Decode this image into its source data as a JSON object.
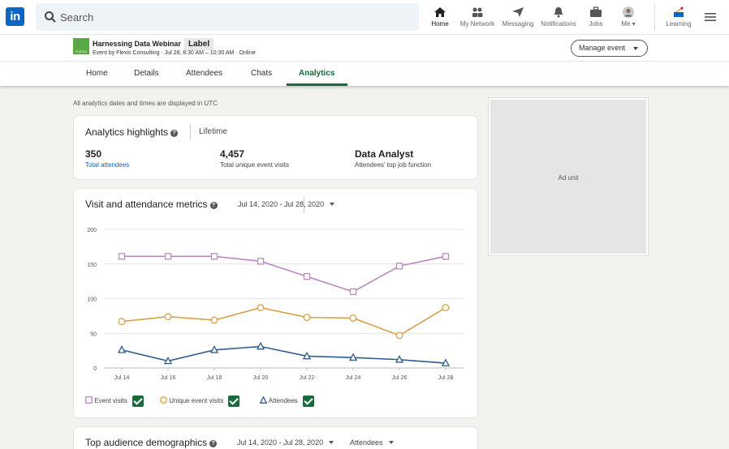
{
  "nav": {
    "search_placeholder": "Search",
    "items": [
      {
        "label": "Home",
        "icon": "home-icon"
      },
      {
        "label": "My Network",
        "icon": "network-icon"
      },
      {
        "label": "Messaging",
        "icon": "messaging-icon"
      },
      {
        "label": "Notifications",
        "icon": "bell-icon"
      },
      {
        "label": "Jobs",
        "icon": "briefcase-icon"
      },
      {
        "label": "Me ▾",
        "icon": "avatar"
      },
      {
        "label": "Learning",
        "icon": "learning-icon"
      }
    ]
  },
  "event": {
    "title": "Harnessing Data Webinar",
    "label": "Label",
    "subtitle": "Event by Flexis Consulting · Jul 28, 8:30 AM – 10:30 AM · Online",
    "manage_button": "Manage event"
  },
  "tabs": [
    "Home",
    "Details",
    "Attendees",
    "Chats",
    "Analytics"
  ],
  "active_tab": "Analytics",
  "note": "All analytics dates and times are displayed in UTC",
  "highlights": {
    "title": "Analytics highlights",
    "period": "Lifetime",
    "stats": [
      {
        "value": "350",
        "label": "Total attendees"
      },
      {
        "value": "4,457",
        "label": "Total unique event visits"
      },
      {
        "value": "Data Analyst",
        "label": "Attendees' top job function"
      }
    ]
  },
  "metrics": {
    "title": "Visit and attendance metrics",
    "daterange": "Jul 14, 2020 - Jul 28, 2020",
    "legend": [
      "Event visits",
      "Unique event visits",
      "Attendees"
    ]
  },
  "demographics": {
    "title": "Top audience demographics",
    "daterange": "Jul 14, 2020 - Jul 28, 2020",
    "filter": "Attendees"
  },
  "ad": {
    "label": "Ad unit"
  },
  "colors": {
    "brand": "#0a66c2",
    "accent": "#1a6b3c",
    "event_visits": "#b98bbd",
    "unique_visits": "#d9a04a",
    "attendees": "#2f5b8c"
  },
  "chart_data": {
    "type": "line",
    "x": [
      "Jul 14",
      "Jul 16",
      "Jul 18",
      "Jul 20",
      "Jul 22",
      "Jul 24",
      "Jul 26",
      "Jul 28"
    ],
    "ylim": [
      0,
      200
    ],
    "yticks": [
      0,
      50,
      100,
      150,
      200
    ],
    "grid": true,
    "series": [
      {
        "name": "Event visits",
        "marker": "square",
        "color": "#b98bbd",
        "values": [
          161,
          161,
          161,
          154,
          132,
          110,
          147,
          161
        ]
      },
      {
        "name": "Unique event visits",
        "marker": "circle",
        "color": "#d9a04a",
        "values": [
          67,
          74,
          69,
          87,
          73,
          72,
          47,
          87
        ]
      },
      {
        "name": "Attendees",
        "marker": "triangle",
        "color": "#2f5b8c",
        "values": [
          26,
          10,
          26,
          31,
          17,
          15,
          12,
          7
        ]
      }
    ]
  }
}
